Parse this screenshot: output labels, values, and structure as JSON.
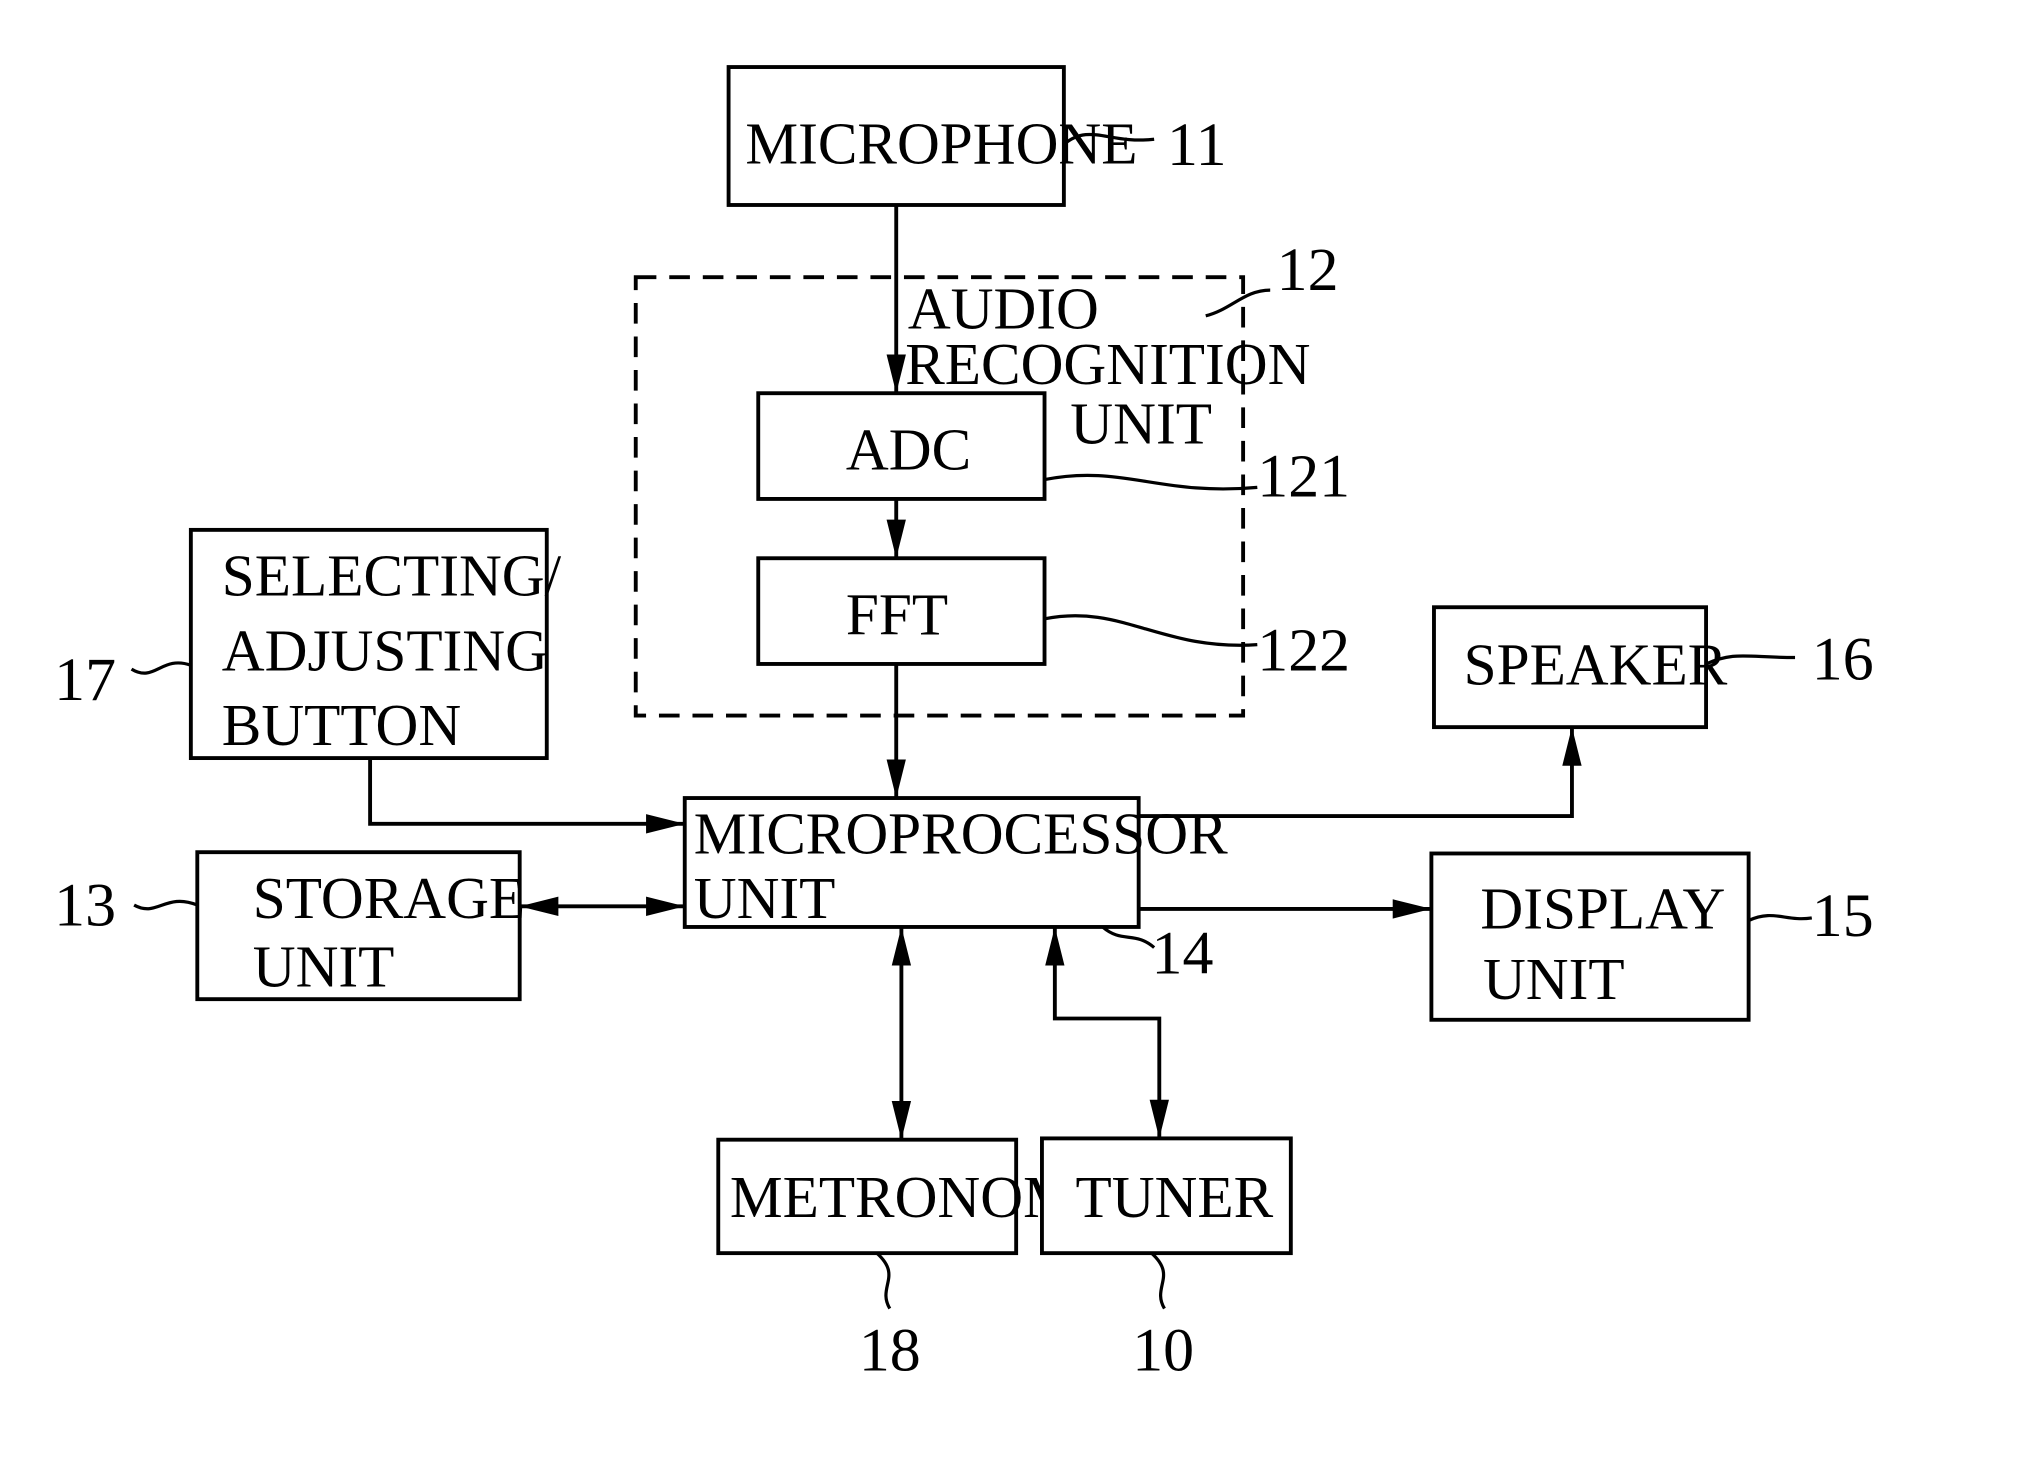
{
  "diagram": {
    "type": "block-diagram",
    "blocks": {
      "microphone": {
        "lines": [
          "MICROPHONE"
        ],
        "ref": "11"
      },
      "audio_recognition": {
        "lines": [
          "AUDIO",
          "RECOGNITION",
          "UNIT"
        ],
        "ref": "12"
      },
      "adc": {
        "lines": [
          "ADC"
        ],
        "ref": "121"
      },
      "fft": {
        "lines": [
          "FFT"
        ],
        "ref": "122"
      },
      "selecting": {
        "lines": [
          "SELECTING/",
          "ADJUSTING",
          "BUTTON"
        ],
        "ref": "17"
      },
      "storage": {
        "lines": [
          "STORAGE",
          "UNIT"
        ],
        "ref": "13"
      },
      "microprocessor": {
        "lines": [
          "MICROPROCESSOR",
          "UNIT"
        ],
        "ref": "14"
      },
      "speaker": {
        "lines": [
          "SPEAKER"
        ],
        "ref": "16"
      },
      "display": {
        "lines": [
          "DISPLAY",
          "UNIT"
        ],
        "ref": "15"
      },
      "metronome": {
        "lines": [
          "METRONOME"
        ],
        "ref": "18"
      },
      "tuner": {
        "lines": [
          "TUNER"
        ],
        "ref": "10"
      }
    },
    "connections": [
      {
        "from": "microphone",
        "to": "adc",
        "direction": "one-way"
      },
      {
        "from": "adc",
        "to": "fft",
        "direction": "one-way"
      },
      {
        "from": "fft",
        "to": "microprocessor",
        "direction": "one-way"
      },
      {
        "from": "selecting",
        "to": "microprocessor",
        "direction": "one-way"
      },
      {
        "from": "storage",
        "to": "microprocessor",
        "direction": "two-way"
      },
      {
        "from": "microprocessor",
        "to": "speaker",
        "direction": "one-way"
      },
      {
        "from": "microprocessor",
        "to": "display",
        "direction": "one-way"
      },
      {
        "from": "metronome",
        "to": "microprocessor",
        "direction": "two-way"
      },
      {
        "from": "tuner",
        "to": "microprocessor",
        "direction": "two-way"
      }
    ]
  }
}
